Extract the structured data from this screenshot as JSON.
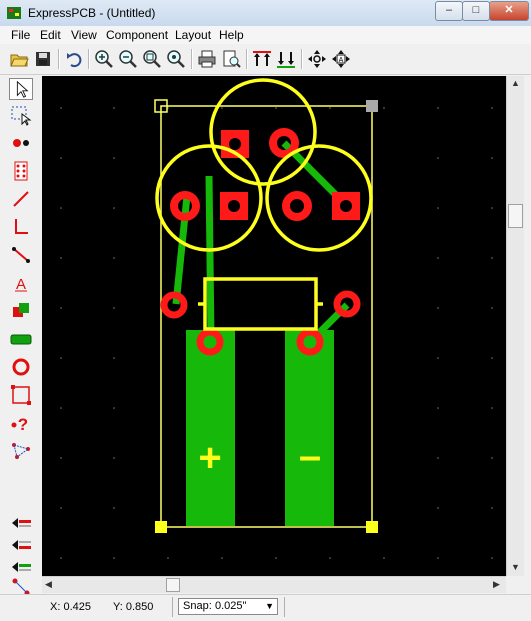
{
  "window": {
    "title": "ExpressPCB - (Untitled)",
    "minimize": "–",
    "maximize": "□",
    "close": "✕"
  },
  "menu": [
    "File",
    "Edit",
    "View",
    "Component",
    "Layout",
    "Help"
  ],
  "toolbar": {
    "icons": [
      "open-folder-icon",
      "save-disk-icon",
      "undo-icon",
      "zoom-in-icon",
      "zoom-out-icon",
      "zoom-window-icon",
      "zoom-fit-icon",
      "print-icon",
      "print-preview-icon",
      "red-traces-icon",
      "green-traces-icon",
      "move-icon",
      "component-move-icon"
    ]
  },
  "left_tools": [
    "pointer-tool",
    "select-region-tool",
    "place-pad-tool",
    "place-component-tool",
    "draw-trace-tool",
    "draw-line-tool",
    "trace-node-tool",
    "place-text-tool",
    "layer-swap-tool",
    "place-filled-shape-tool",
    "place-circle-tool",
    "draw-board-outline-tool",
    "help-tool",
    "net-tool",
    "top-layer-tool",
    "bottom-layer-tool",
    "silk-layer-tool",
    "ratsnest-tool"
  ],
  "silkscreen_text": {
    "plus": "+",
    "minus": "–"
  },
  "status": {
    "x": "X: 0.425",
    "y": "Y: 0.850",
    "snap_label": "Snap:",
    "snap_value": "0.025\""
  },
  "colors": {
    "canvas": "#000000",
    "copper_top": "#ff1a1a",
    "copper_bottom": "#16b80a",
    "silkscreen": "#ffff1e",
    "board_outline": "#ffff66"
  }
}
